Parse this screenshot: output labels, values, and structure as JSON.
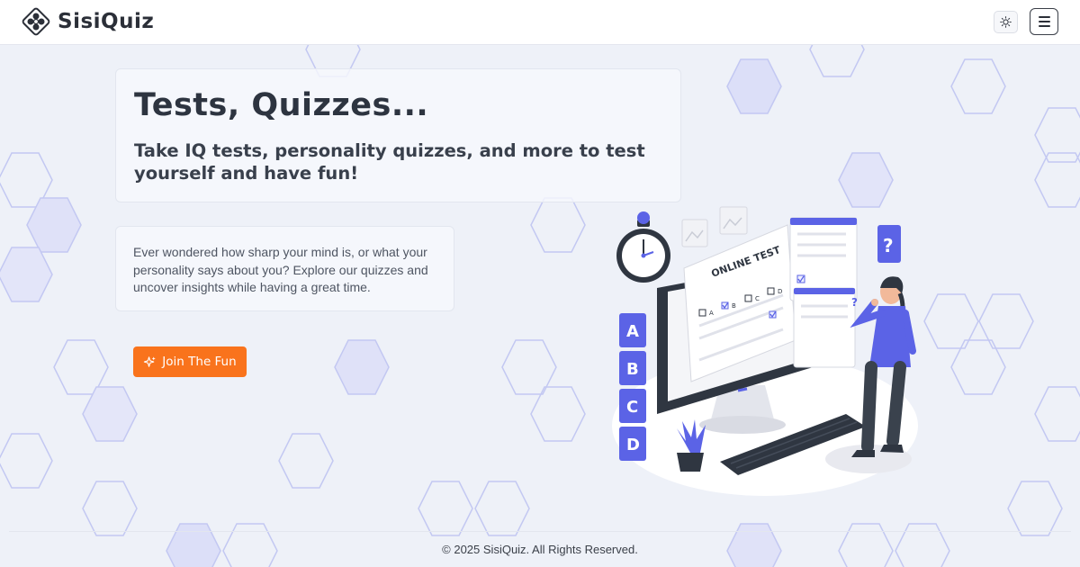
{
  "brand": {
    "name": "SisiQuiz",
    "logo_icon": "circles-logo-icon"
  },
  "navbar": {
    "theme_icon": "sun-icon",
    "menu_icon": "hamburger-menu-icon"
  },
  "hero": {
    "title": "Tests, Quizzes...",
    "subtitle": "Take IQ tests, personality quizzes, and more to test yourself and have fun!"
  },
  "intro": {
    "text": "Ever wondered how sharp your mind is, or what your personality says about you? Explore our quizzes and uncover insights while having a great time."
  },
  "cta": {
    "label": "Join The Fun",
    "icon": "sparkle-icon"
  },
  "illustration": {
    "screen_title": "ONLINE TEST",
    "answer_letters": [
      "A",
      "B",
      "C",
      "D"
    ],
    "question_mark": "?"
  },
  "footer": {
    "copyright": "© 2025 SisiQuiz. All Rights Reserved."
  },
  "colors": {
    "accent": "#f9731c",
    "hex_fill": "#d9dcf7",
    "hex_stroke": "#b9bff0",
    "illustration_blue": "#5b63e6"
  }
}
